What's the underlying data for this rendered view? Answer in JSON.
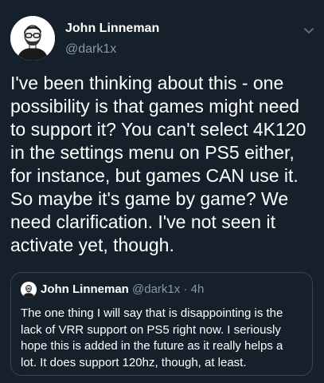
{
  "author": {
    "display_name": "John Linneman",
    "handle": "@dark1x",
    "avatar_icon": "person-avatar-icon",
    "menu_icon": "chevron-down-icon"
  },
  "tweet": {
    "text": "I've been thinking about this - one\npossibility is that games might need\nto support it? You can't select 4K120\nin the settings menu on PS5 either,\nfor instance, but games CAN use it.\nSo maybe it's game by game? We\nneed clarification. I've not seen it\nactivate yet, though."
  },
  "quoted_tweet": {
    "display_name": "John Linneman",
    "handle": "@dark1x",
    "separator": "·",
    "time": "4h",
    "text": "The one thing I will say that is disappointing is the\nlack of VRR support on PS5 right now. I seriously\nhope this is added in the future as it really helps a\nlot. It does support 120hz, though, at least."
  },
  "colors": {
    "background": "#15202b",
    "text_primary": "#ffffff",
    "text_secondary": "#8899a6",
    "border": "#38444d"
  }
}
